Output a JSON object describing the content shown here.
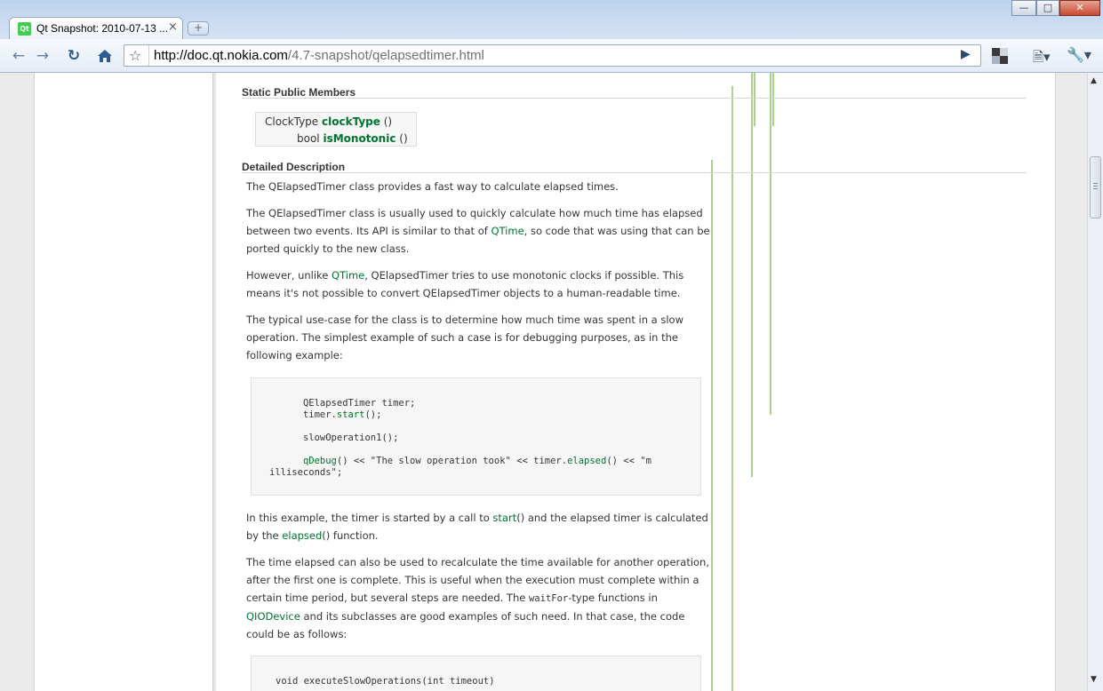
{
  "browser": {
    "tab_title": "Qt Snapshot: 2010-07-13 ...",
    "tab_favicon_text": "Qt",
    "tab_close": "×",
    "new_tab": "+",
    "url_host": "http://doc.qt.nokia.com",
    "url_path": "/4.7-snapshot/qelapsedtimer.html",
    "icons": [
      "back-icon",
      "forward-icon",
      "reload-icon",
      "home-icon",
      "star-icon",
      "go-icon",
      "page-menu-icon",
      "wrench-icon"
    ]
  },
  "page": {
    "static_members_heading": "Static Public Members",
    "members": [
      {
        "type": "ClockType",
        "name": "clockType",
        "args": " ()"
      },
      {
        "type": "bool",
        "name": "isMonotonic",
        "args": " ()"
      }
    ],
    "detailed_heading": "Detailed Description",
    "p1": "The QElapsedTimer class provides a fast way to calculate elapsed times.",
    "p2_a": "The QElapsedTimer class is usually used to quickly calculate how much time has elapsed between two events. Its API is similar to that of ",
    "p2_link": "QTime",
    "p2_b": ", so code that was using that can be ported quickly to the new class.",
    "p3_a": "However, unlike ",
    "p3_link": "QTime",
    "p3_b": ", QElapsedTimer tries to use monotonic clocks if possible. This means it's not possible to convert QElapsedTimer objects to a human-readable time.",
    "p4": "The typical use-case for the class is to determine how much time was spent in a slow operation. The simplest example of such a case is for debugging purposes, as in the following example:",
    "code1": {
      "line1": "QElapsedTimer timer;",
      "line2_a": "timer.",
      "line2_fn": "start",
      "line2_b": "();",
      "line3_a": "slowOperation1",
      "line3_b": "();",
      "line4_fn1": "qDebug",
      "line4_a": "() << \"The slow operation took\" << timer.",
      "line4_fn2": "elapsed",
      "line4_b": "() << \"m",
      "line5": "illiseconds\";"
    },
    "p5_a": "In this example, the timer is started by a call to ",
    "p5_link1": "start",
    "p5_b": "() and the elapsed timer is calculated by the ",
    "p5_link2": "elapsed",
    "p5_c": "() function.",
    "p6_a": "The time elapsed can also be used to recalculate the time available for another operation, after the first one is complete. This is useful when the execution must complete within a certain time period, but several steps are needed. The ",
    "p6_code": "waitFor",
    "p6_b": "-type functions in ",
    "p6_link": "QIODevice",
    "p6_c": " and its subclasses are good examples of such need. In that case, the code could be as follows:",
    "code2_line1": "void executeSlowOperations(int timeout)"
  },
  "colors": {
    "link": "#00732f",
    "text": "#363534",
    "code_bg": "#f6f6f6"
  }
}
